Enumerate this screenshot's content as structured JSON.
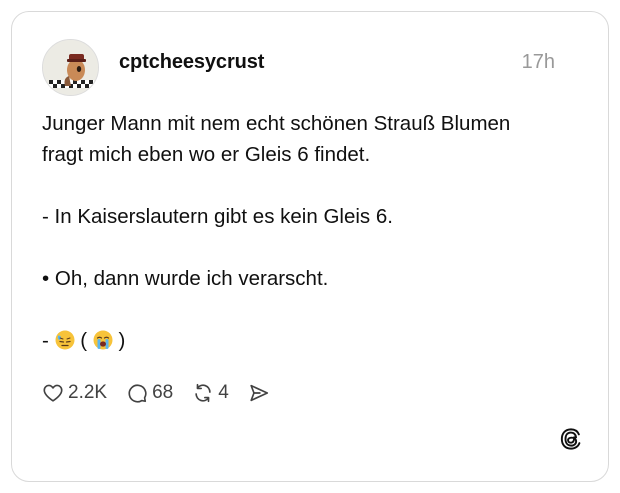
{
  "post": {
    "username": "cptcheesycrust",
    "time": "17h",
    "lines": [
      "Junger Mann mit nem echt schönen Strauß Blumen",
      "fragt mich eben wo er Gleis 6 findet.",
      "- In Kaiserslautern gibt es kein Gleis 6.",
      "• Oh, dann wurde ich verarscht."
    ],
    "last_line": {
      "prefix": "- ",
      "open_paren": " ( ",
      "close_paren": " )"
    }
  },
  "actions": {
    "likes": "2.2K",
    "replies": "68",
    "reposts": "4"
  },
  "icons": [
    "heart-icon",
    "comment-icon",
    "repost-icon",
    "share-icon",
    "threads-logo-icon",
    "downcast-sweat-emoji",
    "crying-emoji"
  ]
}
